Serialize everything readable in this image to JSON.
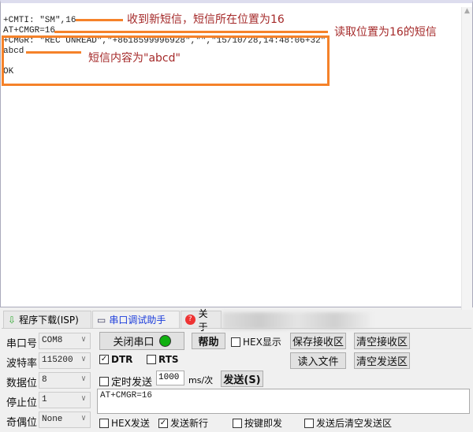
{
  "receive": {
    "lines": [
      "+CMTI: \"SM\",16",
      "AT+CMGR=16",
      "+CMGR: \"REC UNREAD\",\"+8618599996928\",\"\",\"15/10/28,14:48:06+32\"",
      "abcd",
      "",
      "OK"
    ]
  },
  "annotations": [
    "收到新短信，短信所在位置为16",
    "读取位置为16的短信",
    "短信内容为\"abcd\""
  ],
  "annotation_color": "#a52a2a",
  "highlight_color": "#f5822a",
  "tabs": [
    {
      "label": "程序下载(ISP)",
      "icon": "download-arrow-icon"
    },
    {
      "label": "串口调试助手",
      "icon": "serial-port-icon",
      "active": true
    },
    {
      "label": "关于",
      "icon": "help-icon"
    }
  ],
  "settings": [
    {
      "label": "串口号",
      "value": "COM8"
    },
    {
      "label": "波特率",
      "value": "115200"
    },
    {
      "label": "数据位",
      "value": "8"
    },
    {
      "label": "停止位",
      "value": "1"
    },
    {
      "label": "奇偶位",
      "value": "None"
    }
  ],
  "buttons": {
    "close_port": "关闭串口",
    "help": "帮助",
    "save_recv": "保存接收区",
    "clear_recv": "清空接收区",
    "read_file": "读入文件",
    "clear_send": "清空发送区",
    "send": "发送(S)"
  },
  "checks": {
    "hex_display": {
      "label": "HEX显示",
      "checked": false
    },
    "dtr": {
      "label": "DTR",
      "checked": true
    },
    "rts": {
      "label": "RTS",
      "checked": false
    },
    "timed_send": {
      "label": "定时发送",
      "checked": false
    },
    "hex_send": {
      "label": "HEX发送",
      "checked": false
    },
    "send_newline": {
      "label": "发送新行",
      "checked": true
    },
    "key_send": {
      "label": "按键即发",
      "checked": false
    },
    "clear_after_send": {
      "label": "发送后清空发送区",
      "checked": false
    }
  },
  "interval": {
    "value": "1000",
    "unit": "ms/次"
  },
  "send_text": "AT+CMGR=16",
  "port_led_color": "#10b010"
}
